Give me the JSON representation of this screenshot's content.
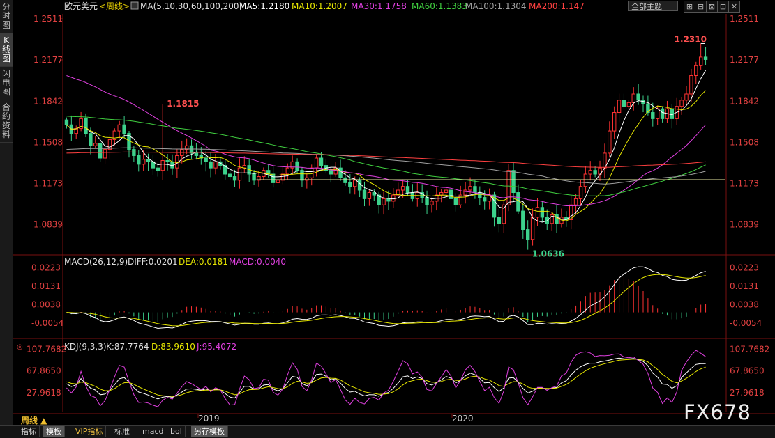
{
  "left_rail": {
    "tabs": [
      {
        "label": "分时图",
        "active": false
      },
      {
        "label": "K线图",
        "active": true
      },
      {
        "label": "闪电图",
        "active": false
      },
      {
        "label": "合约资料",
        "active": false
      }
    ]
  },
  "header": {
    "symbol": "欧元美元",
    "period": "<周线>",
    "ma_label": "MA(5,10,30,60,100,200)",
    "ma_values": [
      {
        "text": "MA5:1.2180",
        "color": "#ffffff"
      },
      {
        "text": "MA10:1.2007",
        "color": "#e6e600"
      },
      {
        "text": "MA30:1.1758",
        "color": "#e040e0"
      },
      {
        "text": "MA60:1.1383",
        "color": "#40d040"
      },
      {
        "text": "MA100:1.1304",
        "color": "#a0a0a0"
      },
      {
        "text": "MA200:1.147",
        "color": "#ff4040"
      }
    ],
    "theme_select": "全部主题",
    "buttons": [
      "⊞",
      "⊟",
      "⊠",
      "⊡",
      "✕"
    ]
  },
  "price_axis": {
    "left": [
      "1.2511",
      "1.2177",
      "1.1842",
      "1.1508",
      "1.1173",
      "1.0839"
    ],
    "right": [
      "1.2511",
      "1.2177",
      "1.1842",
      "1.1508",
      "1.1173",
      "1.0839"
    ],
    "annotations": {
      "high": "1.2310",
      "low": "1.0636",
      "left_high": "1.1815"
    }
  },
  "macd": {
    "label": "MACD(26,12,9)",
    "diff": "DIFF:0.0201",
    "dea": "DEA:0.0181",
    "macd": "MACD:0.0040",
    "axis": [
      "0.0223",
      "0.0131",
      "0.0038",
      "-0.0054"
    ]
  },
  "kdj": {
    "label": "KDJ(9,3,3)",
    "k": "K:87.7764",
    "d": "D:83.9610",
    "j": "J:95.4072",
    "axis": [
      "107.7682",
      "67.8650",
      "27.9618"
    ]
  },
  "x_axis": {
    "labels": [
      "2019",
      "2020"
    ]
  },
  "period_label": "周线 ▲",
  "bottom_tabs": [
    {
      "label": "指标",
      "active": false,
      "vip": false
    },
    {
      "label": "模板",
      "active": true,
      "vip": false
    },
    {
      "label": "VIP指标",
      "active": false,
      "vip": true
    },
    {
      "label": "标准",
      "active": false,
      "vip": false
    },
    {
      "label": "macd",
      "active": false,
      "vip": false
    },
    {
      "label": "bol",
      "active": false,
      "vip": false
    },
    {
      "label": "另存模板",
      "active": true,
      "vip": false
    }
  ],
  "watermark": "FX678",
  "colors": {
    "up": "#ff3232",
    "down": "#3cd28c",
    "grid": "#3a0000"
  },
  "chart_data": {
    "type": "candlestick",
    "title": "欧元美元 <周线>",
    "ylim": [
      1.06,
      1.255
    ],
    "weekly_close_series": [
      1.165,
      1.158,
      1.162,
      1.17,
      1.158,
      1.148,
      1.15,
      1.138,
      1.145,
      1.153,
      1.16,
      1.165,
      1.158,
      1.145,
      1.14,
      1.133,
      1.137,
      1.135,
      1.13,
      1.128,
      1.136,
      1.135,
      1.13,
      1.14,
      1.145,
      1.148,
      1.142,
      1.14,
      1.138,
      1.135,
      1.13,
      1.135,
      1.132,
      1.125,
      1.123,
      1.12,
      1.13,
      1.132,
      1.125,
      1.12,
      1.123,
      1.128,
      1.125,
      1.118,
      1.12,
      1.125,
      1.13,
      1.135,
      1.128,
      1.12,
      1.122,
      1.13,
      1.138,
      1.132,
      1.128,
      1.125,
      1.13,
      1.122,
      1.118,
      1.115,
      1.12,
      1.112,
      1.105,
      1.11,
      1.108,
      1.1,
      1.105,
      1.103,
      1.108,
      1.112,
      1.115,
      1.11,
      1.105,
      1.11,
      1.106,
      1.1,
      1.103,
      1.108,
      1.11,
      1.112,
      1.105,
      1.1,
      1.108,
      1.112,
      1.115,
      1.11,
      1.106,
      1.103,
      1.108,
      1.09,
      1.085,
      1.1,
      1.128,
      1.11,
      1.095,
      1.08,
      1.072,
      1.09,
      1.098,
      1.09,
      1.085,
      1.092,
      1.085,
      1.09,
      1.088,
      1.1,
      1.105,
      1.115,
      1.125,
      1.128,
      1.125,
      1.13,
      1.142,
      1.16,
      1.175,
      1.185,
      1.18,
      1.183,
      1.19,
      1.185,
      1.182,
      1.175,
      1.17,
      1.178,
      1.17,
      1.178,
      1.17,
      1.18,
      1.185,
      1.19,
      1.205,
      1.213,
      1.22,
      1.218
    ],
    "highs_lows": {
      "period_high": 1.231,
      "period_low": 1.0636,
      "left_high": 1.1815
    },
    "indicators": {
      "MA5": 1.218,
      "MA10": 1.2007,
      "MA30": 1.1758,
      "MA60": 1.1383,
      "MA100": 1.1304,
      "MA200": 1.147,
      "MACD": {
        "DIFF": 0.0201,
        "DEA": 0.0181,
        "MACD": 0.004
      },
      "KDJ": {
        "K": 87.7764,
        "D": 83.961,
        "J": 95.4072
      }
    },
    "x_ticks": [
      "2019",
      "2020"
    ]
  }
}
